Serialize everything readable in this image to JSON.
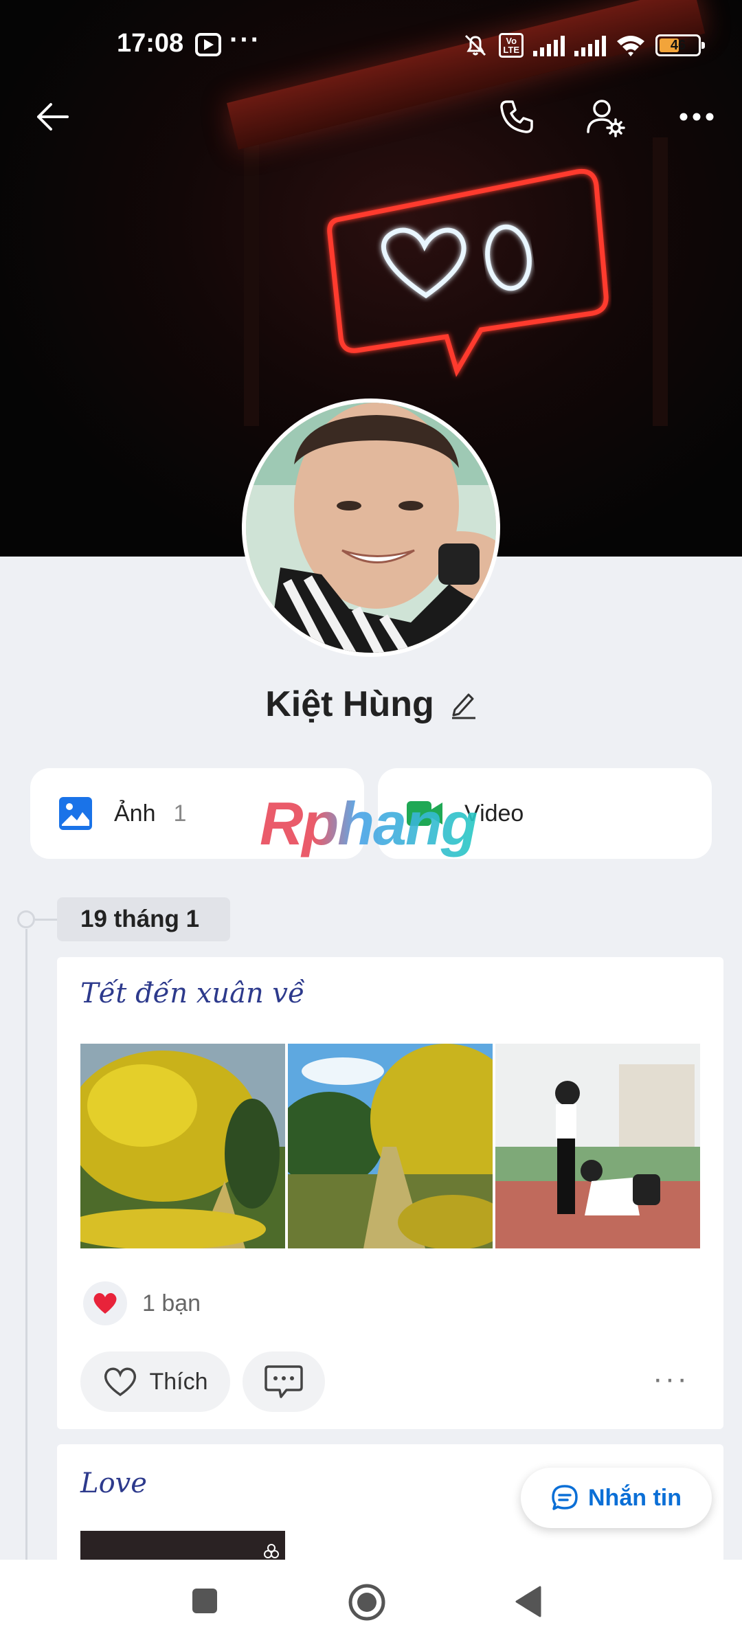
{
  "status_bar": {
    "time": "17:08",
    "dots": "···",
    "battery": "46",
    "volte": "Vo\nLTE"
  },
  "header": {
    "back_icon": "arrow-left-icon",
    "call_icon": "phone-icon",
    "settings_icon": "user-settings-icon",
    "more_icon": "more-horizontal-icon"
  },
  "profile": {
    "name": "Kiệt Hùng"
  },
  "media": {
    "photos_label": "Ảnh",
    "photos_count": "1",
    "video_label": "Video"
  },
  "watermark": "Rphang",
  "timeline": {
    "date": "19 tháng 1"
  },
  "posts": [
    {
      "title": "Tết đến xuân về",
      "reaction_text": "1 bạn",
      "like_label": "Thích",
      "more": "···"
    },
    {
      "title": "Love"
    }
  ],
  "message_button": {
    "label": "Nhắn tin"
  },
  "colors": {
    "accent": "#0b6fd6",
    "photo_icon": "#1a73e8",
    "video_icon": "#1fa855",
    "heart": "#e8233a"
  }
}
